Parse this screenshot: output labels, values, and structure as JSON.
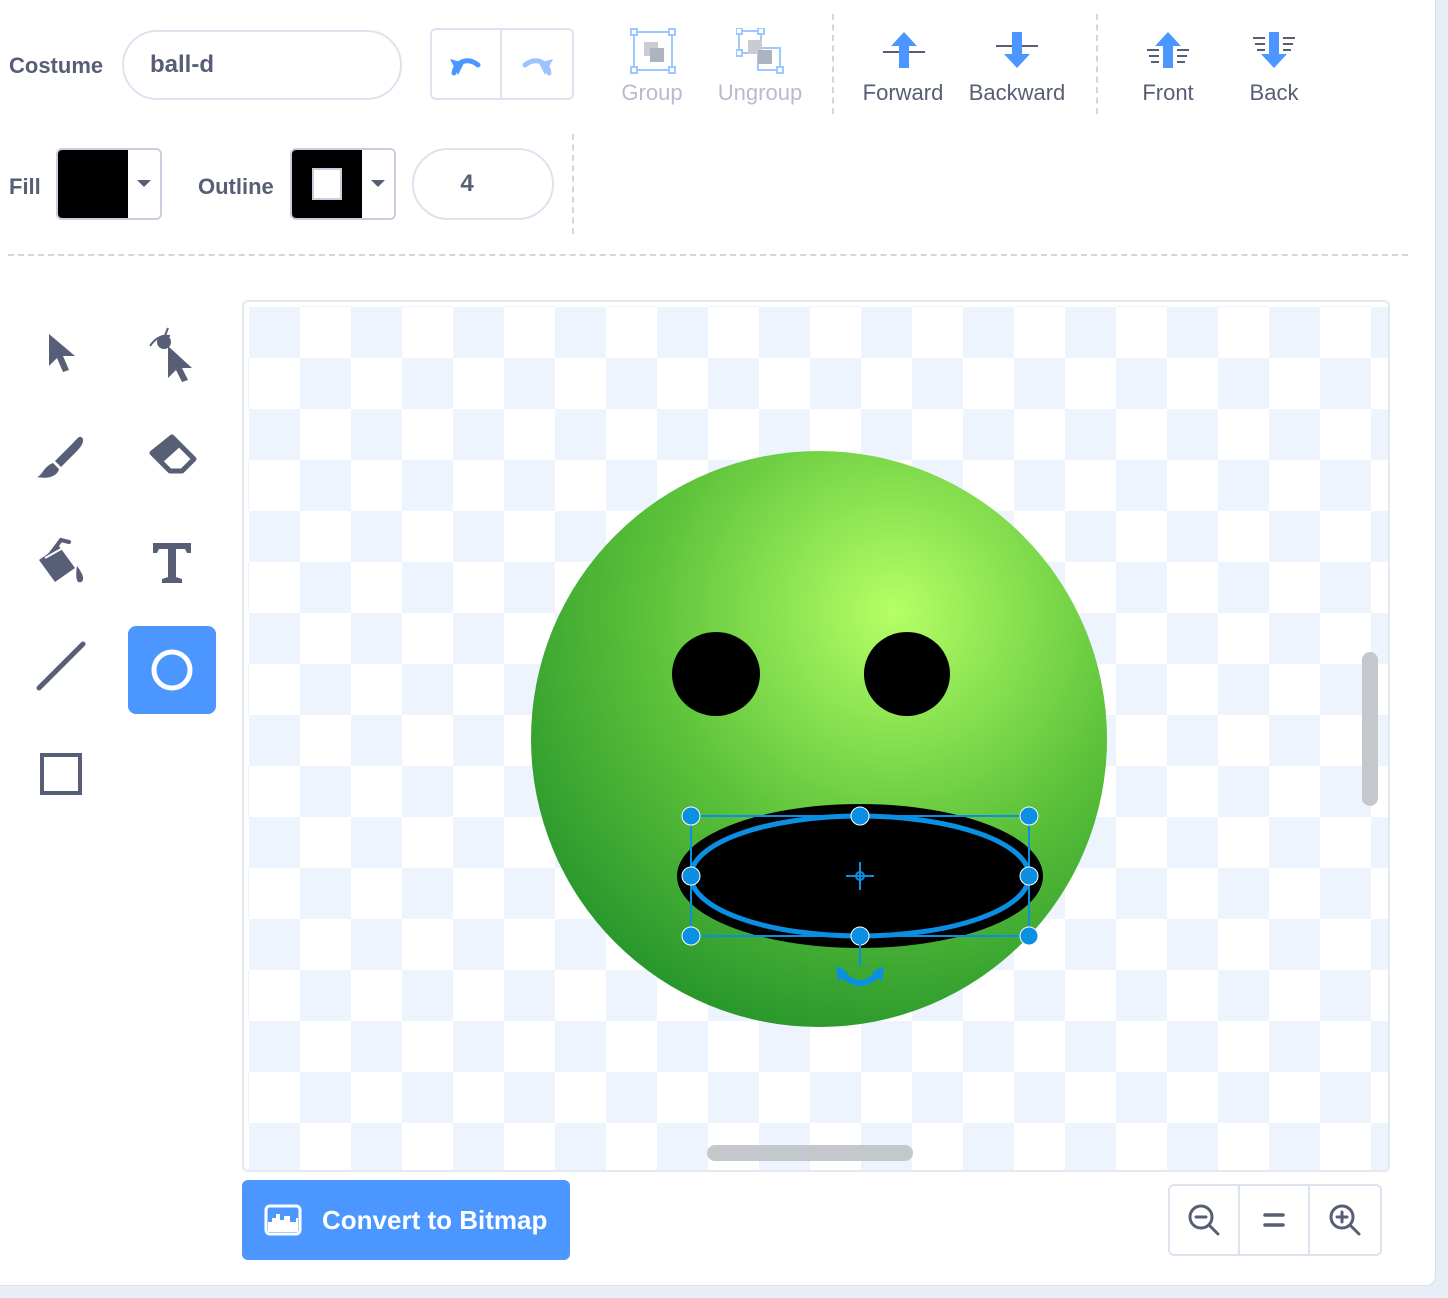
{
  "costume": {
    "label": "Costume",
    "name": "ball-d"
  },
  "toolbar": {
    "group": "Group",
    "ungroup": "Ungroup",
    "forward": "Forward",
    "backward": "Backward",
    "front": "Front",
    "back": "Back"
  },
  "fill": {
    "label": "Fill",
    "color": "#000000"
  },
  "outline": {
    "label": "Outline",
    "color": "#000000",
    "width": "4"
  },
  "tools": {
    "active": "circle-tool",
    "icons": [
      "select-arrow-icon",
      "reshape-icon",
      "brush-icon",
      "eraser-icon",
      "fill-bucket-icon",
      "text-icon",
      "line-icon",
      "circle-icon",
      "rectangle-icon"
    ]
  },
  "canvas": {
    "face_gradient": [
      "#b5ff66",
      "#5cc23a",
      "#1a8a28"
    ],
    "selection_color": "#0b8fe3"
  },
  "convert_button": {
    "label": "Convert to Bitmap",
    "color": "#4c97ff"
  },
  "zoom": {
    "zoom_out": "zoom-out-icon",
    "reset": "zoom-reset-icon",
    "zoom_in": "zoom-in-icon"
  }
}
